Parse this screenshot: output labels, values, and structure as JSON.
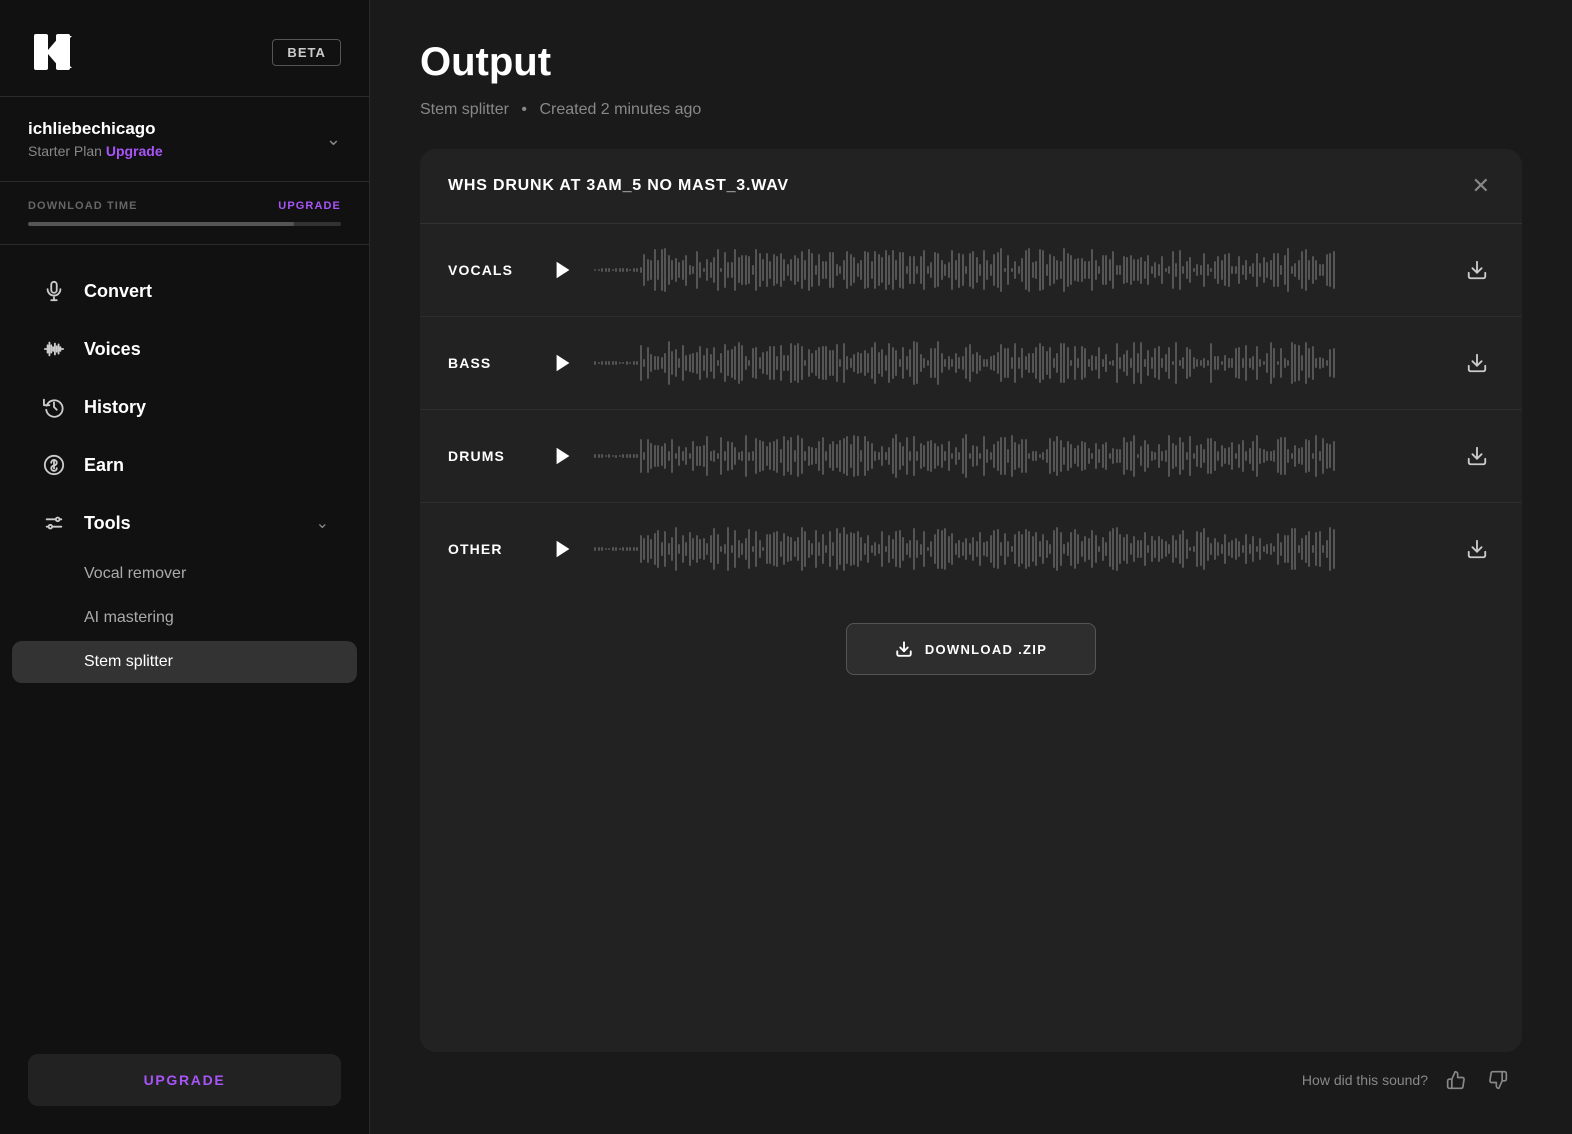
{
  "app": {
    "logo_alt": "K Logo",
    "beta_label": "BETA"
  },
  "user": {
    "name": "ichliebechicago",
    "plan_label": "Starter Plan",
    "upgrade_label": "Upgrade",
    "chevron": "chevron-down"
  },
  "download_time": {
    "label": "DOWNLOAD TIME",
    "upgrade_label": "UPGRADE",
    "progress_percent": 85
  },
  "nav": {
    "items": [
      {
        "id": "convert",
        "label": "Convert",
        "icon": "microphone"
      },
      {
        "id": "voices",
        "label": "Voices",
        "icon": "waveform"
      },
      {
        "id": "history",
        "label": "History",
        "icon": "history"
      },
      {
        "id": "earn",
        "label": "Earn",
        "icon": "dollar"
      },
      {
        "id": "tools",
        "label": "Tools",
        "icon": "tools",
        "has_chevron": true
      }
    ],
    "sub_items": [
      {
        "id": "vocal-remover",
        "label": "Vocal remover"
      },
      {
        "id": "ai-mastering",
        "label": "AI mastering"
      },
      {
        "id": "stem-splitter",
        "label": "Stem splitter",
        "active": true
      }
    ]
  },
  "upgrade_button": {
    "label": "UPGRADE"
  },
  "main": {
    "title": "Output",
    "subtitle_tool": "Stem splitter",
    "subtitle_separator": "•",
    "subtitle_time": "Created 2 minutes ago"
  },
  "output_card": {
    "file_name": "WHS DRUNK AT 3AM_5 NO MAST_3.WAV",
    "tracks": [
      {
        "id": "vocals",
        "label": "VOCALS"
      },
      {
        "id": "bass",
        "label": "BASS"
      },
      {
        "id": "drums",
        "label": "DRUMS"
      },
      {
        "id": "other",
        "label": "OTHER"
      }
    ],
    "download_zip_label": "DOWNLOAD .ZIP"
  },
  "feedback": {
    "label": "How did this sound?"
  }
}
